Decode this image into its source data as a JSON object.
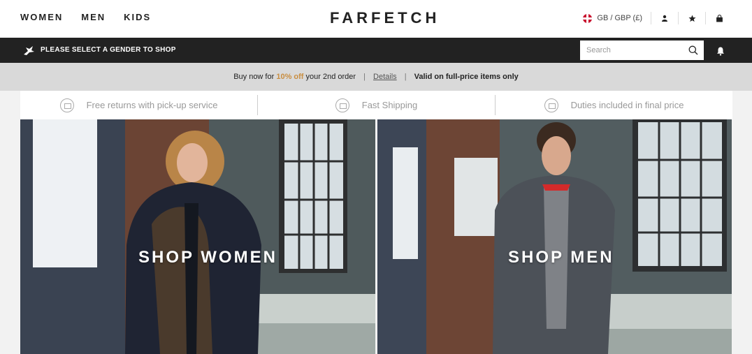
{
  "header": {
    "nav": [
      "WOMEN",
      "MEN",
      "KIDS"
    ],
    "logo": "FARFETCH",
    "locale": "GB / GBP (£)",
    "icons": [
      "user-icon",
      "star-icon",
      "bag-icon"
    ]
  },
  "gender_bar": {
    "message": "PLEASE SELECT A GENDER TO SHOP",
    "search_placeholder": "Search"
  },
  "promo": {
    "prefix": "Buy now for ",
    "highlight": "10% off",
    "suffix": " your 2nd order",
    "link": "Details",
    "note": "Valid on full-price items only"
  },
  "benefits": [
    {
      "icon": "return-box-icon",
      "label": "Free returns with pick-up service"
    },
    {
      "icon": "shipping-icon",
      "label": "Fast Shipping"
    },
    {
      "icon": "duties-icon",
      "label": "Duties included in final price"
    }
  ],
  "heroes": {
    "women_cta": "SHOP WOMEN",
    "men_cta": "SHOP MEN"
  },
  "colors": {
    "accent": "#c98e41",
    "black_bar": "#222222",
    "promo_bg": "#d9d9d9"
  }
}
